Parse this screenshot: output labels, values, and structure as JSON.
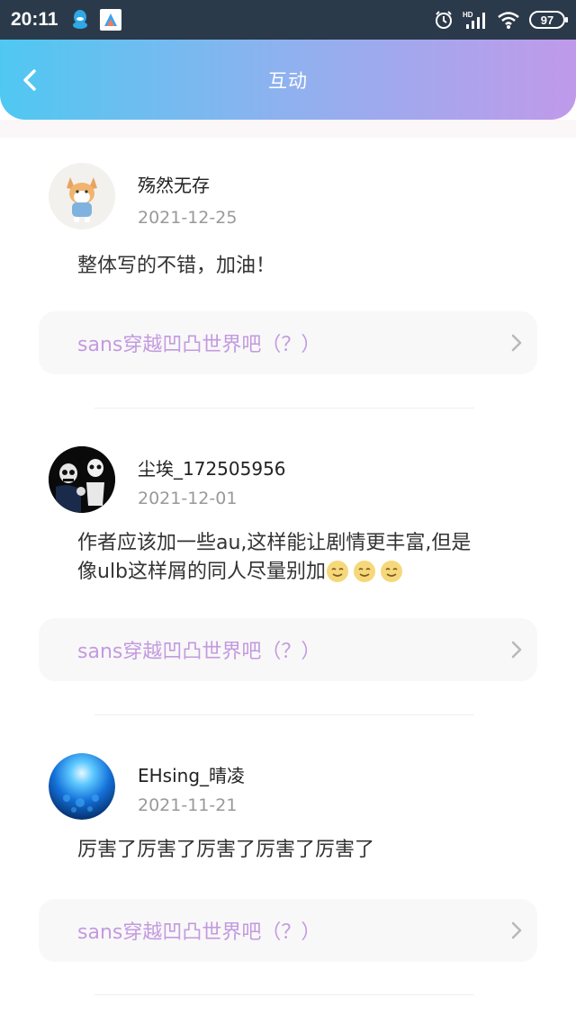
{
  "status_bar": {
    "time": "20:11",
    "battery": "97",
    "icons": [
      "qq-icon",
      "app-icon",
      "alarm-icon",
      "signal-icon",
      "wifi-icon",
      "battery-icon"
    ]
  },
  "header": {
    "title": "互动",
    "back_icon": "chevron-left-icon"
  },
  "colors": {
    "header_gradient": [
      "#4fc8f1",
      "#c09aea"
    ],
    "link_text": "#c39ae0",
    "date_text": "#999999"
  },
  "comments": [
    {
      "username": "殇然无存",
      "date": "2021-12-25",
      "content": "整体写的不错，加油！",
      "book_title": "sans穿越凹凸世界吧（？）",
      "avatar": "avatar-corgi"
    },
    {
      "username": "尘埃_172505956",
      "date": "2021-12-01",
      "content_line1": "作者应该加一些au,这样能让剧情更丰富,但是",
      "content_line2": "像ulb这样屑的同人尽量别加",
      "book_title": "sans穿越凹凸世界吧（？）",
      "avatar": "avatar-skeleton"
    },
    {
      "username": "EHsing_晴凌",
      "date": "2021-11-21",
      "content": "厉害了厉害了厉害了厉害了厉害了",
      "book_title": "sans穿越凹凸世界吧（？）",
      "avatar": "avatar-blue-glow"
    }
  ]
}
